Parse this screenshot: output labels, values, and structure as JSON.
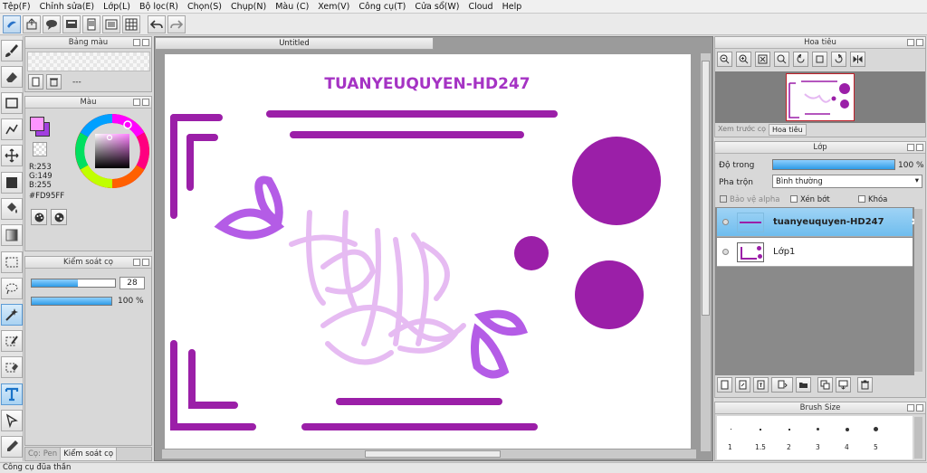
{
  "menu": [
    "Tệp(F)",
    "Chỉnh sửa(E)",
    "Lớp(L)",
    "Bộ lọc(R)",
    "Chọn(S)",
    "Chụp(N)",
    "Màu (C)",
    "Xem(V)",
    "Công cụ(T)",
    "Cửa sổ(W)",
    "Cloud",
    "Help"
  ],
  "toolbar_icons": [
    "app-logo-icon",
    "export-icon",
    "chat-icon",
    "document-icon",
    "page-icon",
    "list-icon",
    "grid-icon",
    "undo-icon",
    "redo-icon"
  ],
  "tools": [
    "brush-icon",
    "eraser-icon",
    "rectangle-icon",
    "polyline-icon",
    "move-icon",
    "fill-square-icon",
    "bucket-icon",
    "gradient-icon",
    "rect-select-icon",
    "lasso-icon",
    "magic-wand-icon",
    "select-pen-icon",
    "select-eraser-icon",
    "text-icon",
    "pick-icon",
    "eyedropper-icon"
  ],
  "palette_panel": {
    "title": "Bảng màu",
    "label": "---"
  },
  "color_panel": {
    "title": "Màu",
    "r": "R:253",
    "g": "G:149",
    "b": "B:255",
    "hex": "#FD95FF",
    "fg_color": "#FD95FF",
    "bg_color": "#A23FE0"
  },
  "brush_control": {
    "title": "Kiểm soát cọ",
    "size": "28",
    "size_fraction": 0.55,
    "opacity": "100 %",
    "opacity_fraction": 1.0
  },
  "left_tabs": [
    "Cọ: Pen",
    "Kiểm soát cọ"
  ],
  "document": {
    "tab": "Untitled",
    "heading": "TUANYEUQUYEN-HD247",
    "accent": "#9B1FA8",
    "scribble": "#E5B8F2"
  },
  "navigator": {
    "title": "Hoa tiêu",
    "tabs": [
      "Xem trước cọ",
      "Hoa tiêu"
    ]
  },
  "layers_panel": {
    "title": "Lớp",
    "opacity_label": "Độ trong",
    "opacity_value": "100 %",
    "opacity_fraction": 1.0,
    "blend_label": "Pha trộn",
    "blend_value": "Bình thường",
    "options": [
      "Bảo vệ alpha",
      "Xén bớt",
      "Khóa"
    ],
    "layers": [
      {
        "name": "tuanyeuquyen-HD247",
        "selected": true
      },
      {
        "name": "Lớp1",
        "selected": false
      }
    ]
  },
  "brush_size": {
    "title": "Brush Size",
    "sizes": [
      "1",
      "1.5",
      "2",
      "3",
      "4",
      "5"
    ]
  },
  "status": "Công cụ đũa thần"
}
